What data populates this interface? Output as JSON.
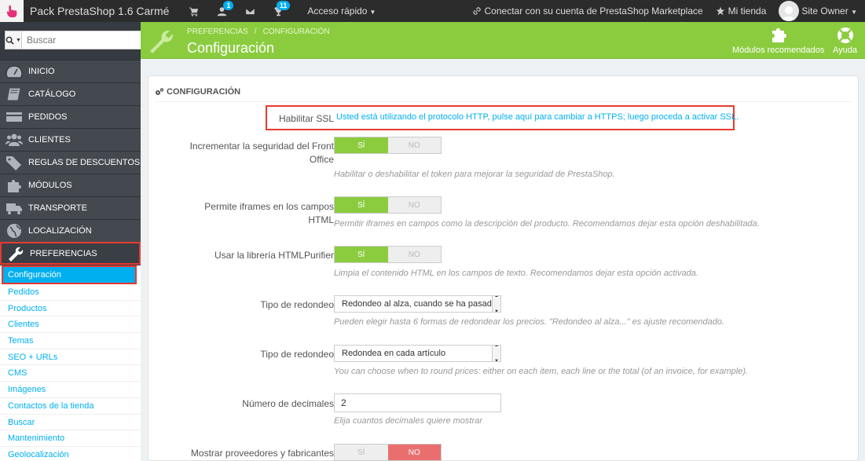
{
  "topbar": {
    "shop_name": "Pack PrestaShop 1.6 Carmé",
    "customers_badge": "1",
    "trophy_badge": "11",
    "quick_access": "Acceso rápido",
    "marketplace": "Conectar con su cuenta de PrestaShop Marketplace",
    "my_shop": "Mi tienda",
    "owner": "Site Owner"
  },
  "sidebar": {
    "search_placeholder": "Buscar",
    "items": [
      {
        "label": "Inicio"
      },
      {
        "label": "Catálogo"
      },
      {
        "label": "Pedidos"
      },
      {
        "label": "Clientes"
      },
      {
        "label": "Reglas de descuentos"
      },
      {
        "label": "Módulos"
      },
      {
        "label": "Transporte"
      },
      {
        "label": "Localización"
      },
      {
        "label": "Preferencias"
      }
    ],
    "submenu": [
      {
        "label": "Configuración"
      },
      {
        "label": "Pedidos"
      },
      {
        "label": "Productos"
      },
      {
        "label": "Clientes"
      },
      {
        "label": "Temas"
      },
      {
        "label": "SEO + URLs"
      },
      {
        "label": "CMS"
      },
      {
        "label": "Imágenes"
      },
      {
        "label": "Contactos de la tienda"
      },
      {
        "label": "Buscar"
      },
      {
        "label": "Mantenimiento"
      },
      {
        "label": "Geolocalización"
      }
    ]
  },
  "header": {
    "breadcrumb_1": "Preferencias",
    "breadcrumb_2": "Configuración",
    "title": "Configuración",
    "modules_label": "Módulos recomendados",
    "help_label": "Ayuda"
  },
  "panel": {
    "title": "Configuración",
    "ssl_label": "Habilitar SSL",
    "ssl_text": "Usted está utilizando el protocolo HTTP, pulse aquí para cambiar a HTTPS; luego proceda a activar SSL.",
    "yes": "Sí",
    "no": "No",
    "fields": [
      {
        "label": "Incrementar la seguridad del Front Office",
        "help": "Habilitar o deshabilitar el token para mejorar la seguridad de PrestaShop."
      },
      {
        "label": "Permite iframes en los campos HTML",
        "help": "Permitir iframes en campos como la descripción del producto. Recomendamos dejar esta opción deshabilitada."
      },
      {
        "label": "Usar la librería HTMLPurifier",
        "help": "Limpia el contenido HTML en los campos de texto. Recomendamos dejar esta opción activada."
      },
      {
        "label": "Tipo de redondeo",
        "value": "Redondeo al alza, cuando se ha pasad",
        "help": "Pueden elegir hasta 6 formas de redondear los precios. \"Redondeo al alza...\" es ajuste recomendado."
      },
      {
        "label": "Tipo de redondeo",
        "value": "Redondea en cada artículo",
        "help": "You can choose when to round prices: either on each item, each line or the total (of an invoice, for example)."
      },
      {
        "label": "Número de decimales",
        "value": "2",
        "help": "Elija cuantos decimales quiere mostrar"
      },
      {
        "label": "Mostrar proveedores y fabricantes"
      }
    ]
  }
}
